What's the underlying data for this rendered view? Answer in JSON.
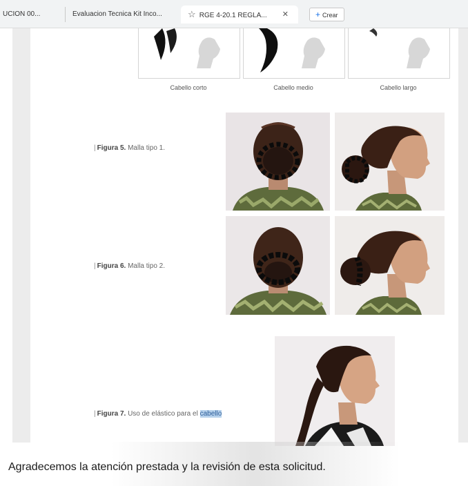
{
  "tabs": [
    {
      "label": "UCION 00..."
    },
    {
      "label": "Evaluacion Tecnica Kit Inco..."
    },
    {
      "label": "RGE 4-20.1 REGLA..."
    }
  ],
  "new_tab": {
    "label": "Crear"
  },
  "hair_lengths": [
    "Cabello corto",
    "Cabello medio",
    "Cabello largo"
  ],
  "figures": {
    "fig5": {
      "num": "Figura 5.",
      "text": "Malla tipo 1."
    },
    "fig6": {
      "num": "Figura 6.",
      "text": "Malla tipo 2."
    },
    "fig7": {
      "num": "Figura 7.",
      "text": "Uso de elástico para el ",
      "highlight": "cabello"
    }
  },
  "closing_text": "Agradecemos la atención prestada y la revisión de esta solicitud.",
  "colors": {
    "highlight": "#b6d1ec",
    "tab_active": "#ffffff",
    "tabbar": "#f1f3f4"
  }
}
